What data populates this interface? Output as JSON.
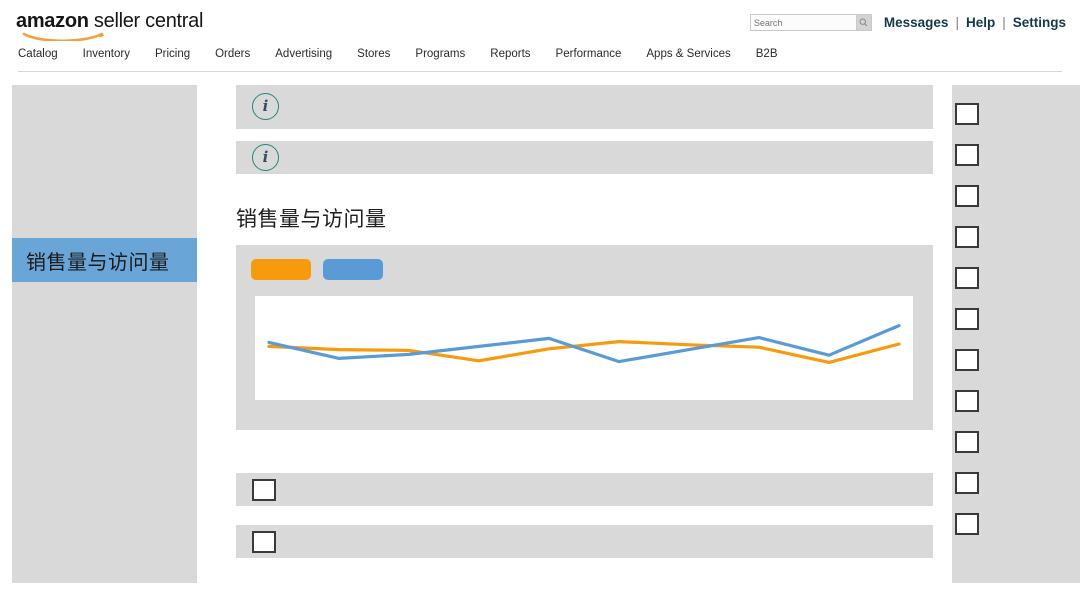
{
  "header": {
    "logo": {
      "brand": "amazon",
      "product": " seller central",
      "smile_color": "#f0a33a"
    },
    "search": {
      "value": "",
      "placeholder": "Search",
      "icon": "search-icon"
    },
    "links": [
      {
        "label": "Messages"
      },
      {
        "label": "Help"
      },
      {
        "label": "Settings"
      }
    ],
    "separator": "|",
    "nav": [
      {
        "label": "Catalog"
      },
      {
        "label": "Inventory"
      },
      {
        "label": "Pricing"
      },
      {
        "label": "Orders"
      },
      {
        "label": "Advertising"
      },
      {
        "label": "Stores"
      },
      {
        "label": "Programs"
      },
      {
        "label": "Reports"
      },
      {
        "label": "Performance"
      },
      {
        "label": "Apps & Services"
      },
      {
        "label": "B2B"
      }
    ]
  },
  "sidebar": {
    "items": [
      {
        "label": "销售量与访问量",
        "active": true
      }
    ],
    "active_bg": "#6aa5d8"
  },
  "main": {
    "info_banners": [
      {
        "icon": "info-icon",
        "text": ""
      },
      {
        "icon": "info-icon",
        "text": ""
      }
    ],
    "section_title": "销售量与访问量",
    "legend": [
      {
        "name": "series-orange",
        "color": "#f79a0e",
        "label": ""
      },
      {
        "name": "series-blue",
        "color": "#5a9bd5",
        "label": ""
      }
    ],
    "bottom_rows": [
      {
        "checkbox": false,
        "label": ""
      },
      {
        "checkbox": false,
        "label": ""
      }
    ]
  },
  "right_panel": {
    "checkboxes": [
      {
        "checked": false
      },
      {
        "checked": false
      },
      {
        "checked": false
      },
      {
        "checked": false
      },
      {
        "checked": false
      },
      {
        "checked": false
      },
      {
        "checked": false
      },
      {
        "checked": false
      },
      {
        "checked": false
      },
      {
        "checked": false
      },
      {
        "checked": false
      }
    ]
  },
  "chart_data": {
    "type": "line",
    "title": "销售量与访问量",
    "xlabel": "",
    "ylabel": "",
    "grid": false,
    "legend_position": "top-left",
    "x": [
      1,
      2,
      3,
      4,
      5,
      6,
      7,
      8,
      9,
      10
    ],
    "ylim": [
      0,
      100
    ],
    "series": [
      {
        "name": "series-orange",
        "color": "#f79a0e",
        "values": [
          52,
          48,
          47,
          34,
          49,
          58,
          54,
          51,
          32,
          55
        ]
      },
      {
        "name": "series-blue",
        "color": "#5a9bd5",
        "values": [
          57,
          37,
          42,
          52,
          62,
          33,
          48,
          63,
          41,
          78
        ]
      }
    ]
  }
}
